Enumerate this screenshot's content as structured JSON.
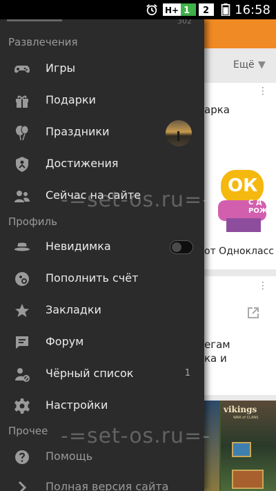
{
  "status_bar": {
    "time": "16:58",
    "icons": [
      "alarm-icon",
      "hplus-network-icon",
      "signal-icon",
      "sim2-network-icon",
      "battery-icon"
    ]
  },
  "background": {
    "more_label": "Ещё",
    "card1_title": "арка",
    "card1_sub": "от Однокласс",
    "card1_image_text": "ОК",
    "card1_image_sub": "С Д РОЖ",
    "card2_line1": "егам",
    "card2_line2": "ка и",
    "card3_game_title": "vikings",
    "card3_game_sub": "WAR of CLANS"
  },
  "drawer": {
    "top_partial": "302",
    "sections": {
      "entertainment": "Развлечения",
      "profile": "Профиль",
      "other": "Прочее"
    },
    "items": {
      "games": "Игры",
      "gifts": "Подарки",
      "holidays": "Праздники",
      "achievements": "Достижения",
      "online_now": "Сейчас на сайте",
      "invisible": "Невидимка",
      "top_up": "Пополнить счёт",
      "bookmarks": "Закладки",
      "forum": "Форум",
      "blacklist": "Чёрный список",
      "blacklist_count": "1",
      "settings": "Настройки",
      "help": "Помощь",
      "full_version": "Полная версия сайта"
    },
    "invisible_toggle_on": false
  },
  "watermark": "-=set-os.ru=-",
  "colors": {
    "drawer_bg": "#2b2b2b",
    "accent_orange": "#f08a24",
    "text_primary": "#ececec",
    "text_secondary": "#9a9a9a"
  }
}
